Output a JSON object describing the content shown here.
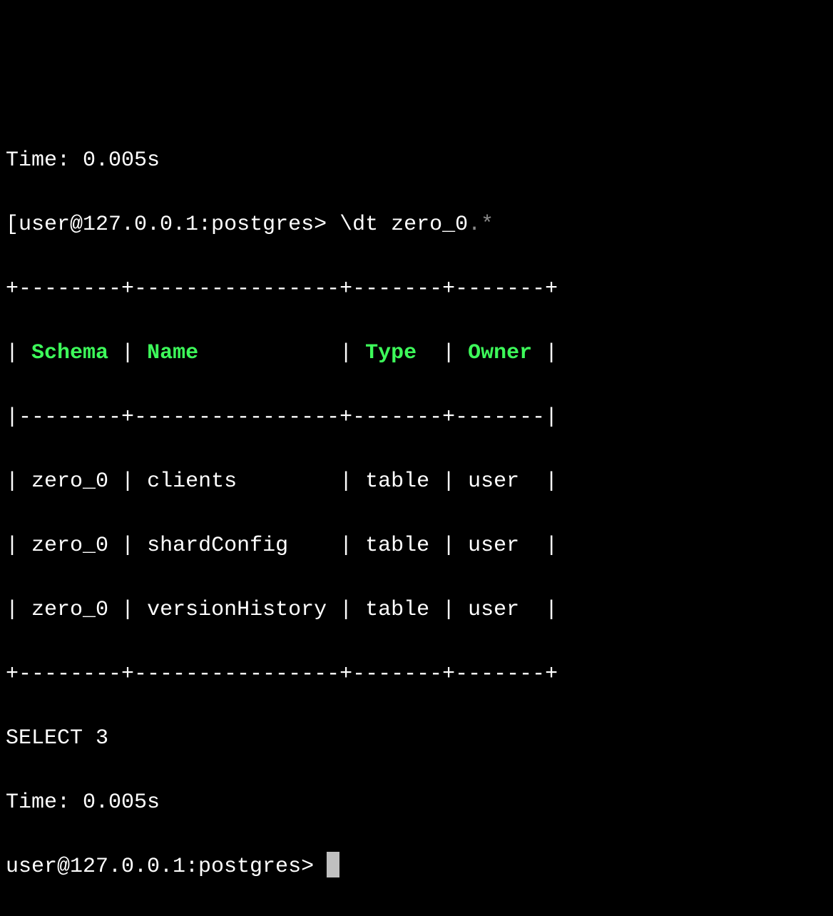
{
  "time_top": "Time: 0.005s",
  "prompt1_prefix": "[",
  "prompt1": "user@127.0.0.1:postgres>",
  "command": "\\dt zero_0",
  "command_dim": ".*",
  "border_top": "+--------+----------------+-------+-------+",
  "header_sep": "|--------+----------------+-------+-------|",
  "border_bot": "+--------+----------------+-------+-------+",
  "headers": {
    "c1": "Schema",
    "c2": "Name",
    "c3": "Type",
    "c4": "Owner"
  },
  "rows": [
    {
      "schema": "zero_0",
      "name": "clients",
      "type": "table",
      "owner": "user"
    },
    {
      "schema": "zero_0",
      "name": "shardConfig",
      "type": "table",
      "owner": "user"
    },
    {
      "schema": "zero_0",
      "name": "versionHistory",
      "type": "table",
      "owner": "user"
    }
  ],
  "result": "SELECT 3",
  "time_bot": "Time: 0.005s",
  "prompt2": "user@127.0.0.1:postgres>"
}
